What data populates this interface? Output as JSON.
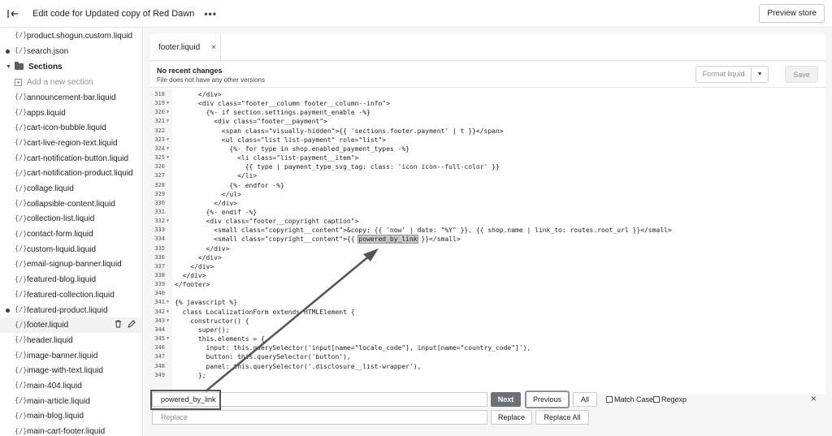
{
  "header": {
    "title": "Edit code for Updated copy of Red Dawn",
    "more": "•••",
    "preview_label": "Preview store"
  },
  "sidebar": {
    "file_icon": "{/}",
    "top_items": [
      {
        "label": "product.shogun.custom.liquid",
        "dot": false
      },
      {
        "label": "search.json",
        "dot": true
      }
    ],
    "section_title": "Sections",
    "add_label": "Add a new section",
    "items": [
      {
        "label": "announcement-bar.liquid",
        "dot": false
      },
      {
        "label": "apps.liquid",
        "dot": false
      },
      {
        "label": "cart-icon-bubble.liquid",
        "dot": false
      },
      {
        "label": "cart-live-region-text.liquid",
        "dot": false
      },
      {
        "label": "cart-notification-button.liquid",
        "dot": false
      },
      {
        "label": "cart-notification-product.liquid",
        "dot": false
      },
      {
        "label": "collage.liquid",
        "dot": false
      },
      {
        "label": "collapsible-content.liquid",
        "dot": false
      },
      {
        "label": "collection-list.liquid",
        "dot": false
      },
      {
        "label": "contact-form.liquid",
        "dot": false
      },
      {
        "label": "custom-liquid.liquid",
        "dot": false
      },
      {
        "label": "email-signup-banner.liquid",
        "dot": false
      },
      {
        "label": "featured-blog.liquid",
        "dot": false
      },
      {
        "label": "featured-collection.liquid",
        "dot": false
      },
      {
        "label": "featured-product.liquid",
        "dot": true
      },
      {
        "label": "footer.liquid",
        "dot": false,
        "active": true
      },
      {
        "label": "header.liquid",
        "dot": false
      },
      {
        "label": "image-banner.liquid",
        "dot": false
      },
      {
        "label": "image-with-text.liquid",
        "dot": false
      },
      {
        "label": "main-404.liquid",
        "dot": false
      },
      {
        "label": "main-article.liquid",
        "dot": false
      },
      {
        "label": "main-blog.liquid",
        "dot": false
      },
      {
        "label": "main-cart-footer.liquid",
        "dot": false
      }
    ]
  },
  "tabs": [
    {
      "label": "footer.liquid",
      "close": "×"
    }
  ],
  "info": {
    "title": "No recent changes",
    "subtitle": "File does not have any other versions",
    "format_label": "Format liquid",
    "save_label": "Save"
  },
  "code_lines": [
    {
      "n": "318",
      "fold": false,
      "t": "      </div>"
    },
    {
      "n": "319",
      "fold": true,
      "t": "      <div class=\"footer__column footer__column--info\">"
    },
    {
      "n": "320",
      "fold": true,
      "t": "        {%- if section.settings.payment_enable -%}"
    },
    {
      "n": "321",
      "fold": true,
      "t": "          <div class=\"footer__payment\">"
    },
    {
      "n": "322",
      "fold": false,
      "t": "            <span class=\"visually-hidden\">{{ 'sections.footer.payment' | t }}</span>"
    },
    {
      "n": "323",
      "fold": true,
      "t": "            <ul class=\"list list-payment\" role=\"list\">"
    },
    {
      "n": "324",
      "fold": true,
      "t": "              {%- for type in shop.enabled_payment_types -%}"
    },
    {
      "n": "325",
      "fold": true,
      "t": "                <li class=\"list-payment__item\">"
    },
    {
      "n": "326",
      "fold": false,
      "t": "                  {{ type | payment_type_svg_tag: class: 'icon icon--full-color' }}"
    },
    {
      "n": "327",
      "fold": false,
      "t": "                </li>"
    },
    {
      "n": "328",
      "fold": false,
      "t": "              {%- endfor -%}"
    },
    {
      "n": "329",
      "fold": false,
      "t": "            </ul>"
    },
    {
      "n": "330",
      "fold": false,
      "t": "          </div>"
    },
    {
      "n": "331",
      "fold": false,
      "t": "        {%- endif -%}"
    },
    {
      "n": "332",
      "fold": true,
      "t": "        <div class=\"footer__copyright caption\">"
    },
    {
      "n": "333",
      "fold": false,
      "t": "          <small class=\"copyright__content\">&copy; {{ 'now' | date: \"%Y\" }}, {{ shop.name | link_to: routes.root_url }}</small>"
    },
    {
      "n": "334",
      "fold": false,
      "pre": "          <small class=\"copyright__content\">{{ ",
      "hl": "powered_by_link",
      "post": " }}</small>"
    },
    {
      "n": "335",
      "fold": false,
      "t": "        </div>"
    },
    {
      "n": "336",
      "fold": false,
      "t": "      </div>"
    },
    {
      "n": "337",
      "fold": false,
      "t": "    </div>"
    },
    {
      "n": "338",
      "fold": false,
      "t": "  </div>"
    },
    {
      "n": "339",
      "fold": false,
      "t": "</footer>"
    },
    {
      "n": "340",
      "fold": false,
      "t": ""
    },
    {
      "n": "341",
      "fold": true,
      "t": "{% javascript %}"
    },
    {
      "n": "342",
      "fold": true,
      "t": "  class LocalizationForm extends HTMLElement {"
    },
    {
      "n": "343",
      "fold": true,
      "t": "    constructor() {"
    },
    {
      "n": "344",
      "fold": false,
      "t": "      super();"
    },
    {
      "n": "345",
      "fold": true,
      "t": "      this.elements = {"
    },
    {
      "n": "346",
      "fold": false,
      "t": "        input: this.querySelector('input[name=\"locale_code\"], input[name=\"country_code\"]'),"
    },
    {
      "n": "347",
      "fold": false,
      "t": "        button: this.querySelector('button'),"
    },
    {
      "n": "348",
      "fold": false,
      "t": "        panel: this.querySelector('.disclosure__list-wrapper'),"
    },
    {
      "n": "349",
      "fold": false,
      "t": "      };"
    }
  ],
  "search": {
    "find_value": "powered_by_link",
    "replace_placeholder": "Replace",
    "next_label": "Next",
    "previous_label": "Previous",
    "all_label": "All",
    "match_case_label": "Match Case",
    "regexp_label": "Regexp",
    "replace_label": "Replace",
    "replace_all_label": "Replace All",
    "close": "×"
  },
  "colors": {
    "next_button": "#6d7175",
    "highlight": "#c8c8c8",
    "arrow": "#555555"
  }
}
